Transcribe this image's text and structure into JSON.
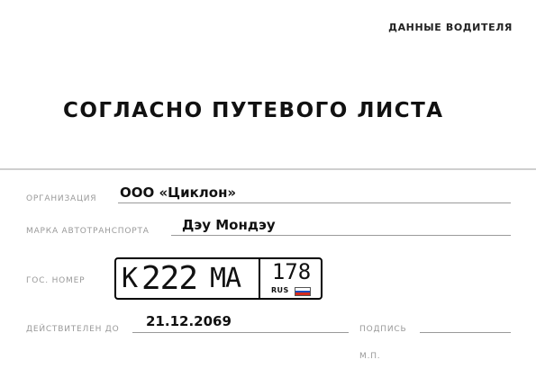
{
  "header": {
    "label": "ДАННЫЕ ВОДИТЕЛЯ"
  },
  "title": "СОГЛАСНО ПУТЕВОГО ЛИСТА",
  "fields": {
    "organization": {
      "label": "ОРГАНИЗАЦИЯ",
      "value": "ООО «Циклон»"
    },
    "vehicle_brand": {
      "label": "МАРКА АВТОТРАНСПОРТА",
      "value": "Дэу Мондэу"
    },
    "plate": {
      "label": "ГОС. НОМЕР",
      "letter1": "К",
      "digits": "222",
      "letters2": "МА",
      "region": "178",
      "country": "RUS"
    },
    "valid_until": {
      "label": "ДЕЙСТВИТЕЛЕН ДО",
      "value": "21.12.2069"
    },
    "signature": {
      "label": "ПОДПИСЬ"
    },
    "stamp": {
      "label": "М.П."
    }
  },
  "colors": {
    "flag_white": "#ffffff",
    "flag_blue": "#1c4fbf",
    "flag_red": "#d52b1e"
  }
}
